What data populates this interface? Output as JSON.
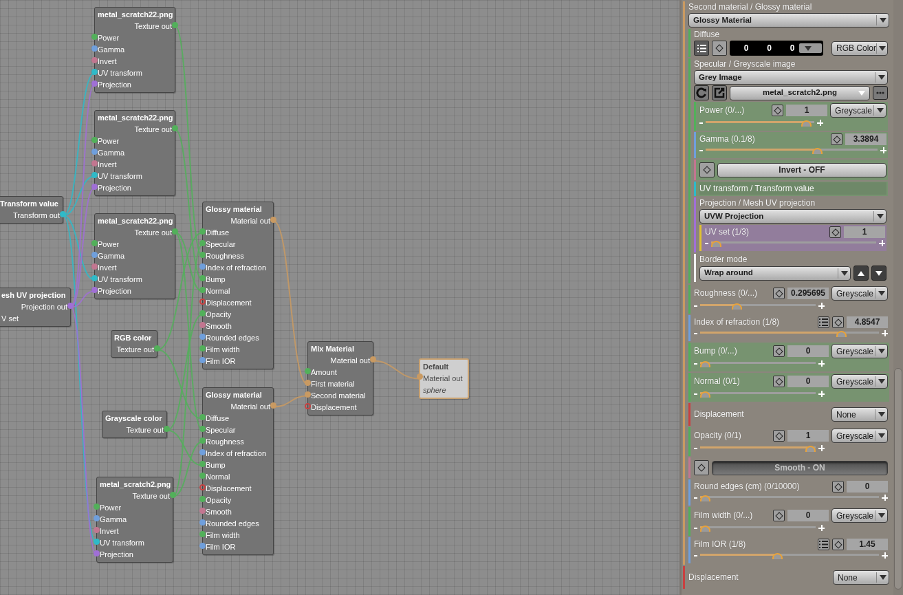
{
  "canvas": {
    "nodes": [
      {
        "title": "metal_scratch22.png",
        "outputs": [
          {
            "label": "Texture out",
            "kind": "texture"
          }
        ],
        "inputs": [
          {
            "label": "Power",
            "kind": "texture"
          },
          {
            "label": "Gamma",
            "kind": "float"
          },
          {
            "label": "Invert",
            "kind": "bool"
          },
          {
            "label": "UV transform",
            "kind": "transform"
          },
          {
            "label": "Projection",
            "kind": "projection"
          }
        ],
        "selected": false
      },
      {
        "title": "metal_scratch22.png",
        "outputs": [
          {
            "label": "Texture out",
            "kind": "texture"
          }
        ],
        "inputs": [
          {
            "label": "Power",
            "kind": "texture"
          },
          {
            "label": "Gamma",
            "kind": "float"
          },
          {
            "label": "Invert",
            "kind": "bool"
          },
          {
            "label": "UV transform",
            "kind": "transform"
          },
          {
            "label": "Projection",
            "kind": "projection"
          }
        ],
        "selected": false
      },
      {
        "title": "metal_scratch22.png",
        "outputs": [
          {
            "label": "Texture out",
            "kind": "texture"
          }
        ],
        "inputs": [
          {
            "label": "Power",
            "kind": "texture"
          },
          {
            "label": "Gamma",
            "kind": "float"
          },
          {
            "label": "Invert",
            "kind": "bool"
          },
          {
            "label": "UV transform",
            "kind": "transform"
          },
          {
            "label": "Projection",
            "kind": "projection"
          }
        ],
        "selected": false
      },
      {
        "title": "Transform value",
        "outputs": [
          {
            "label": "Transform out",
            "kind": "transform"
          }
        ],
        "selected": false
      },
      {
        "title": "esh UV projection",
        "outputs": [
          {
            "label": "Projection out",
            "kind": "projection"
          }
        ],
        "inputs": [
          {
            "label": "V set"
          }
        ],
        "selected": false
      },
      {
        "title": "RGB color",
        "outputs": [
          {
            "label": "Texture out",
            "kind": "texture"
          }
        ],
        "selected": false
      },
      {
        "title": "Grayscale color",
        "outputs": [
          {
            "label": "Texture out",
            "kind": "texture"
          }
        ],
        "selected": false
      },
      {
        "title": "metal_scratch2.png",
        "outputs": [
          {
            "label": "Texture out",
            "kind": "texture"
          }
        ],
        "inputs": [
          {
            "label": "Power",
            "kind": "texture"
          },
          {
            "label": "Gamma",
            "kind": "float"
          },
          {
            "label": "Invert",
            "kind": "bool"
          },
          {
            "label": "UV transform",
            "kind": "transform"
          },
          {
            "label": "Projection",
            "kind": "projection"
          }
        ],
        "selected": false
      },
      {
        "title": "Glossy material",
        "outputs": [
          {
            "label": "Material out",
            "kind": "material"
          }
        ],
        "inputs": [
          {
            "label": "Diffuse",
            "kind": "texture"
          },
          {
            "label": "Specular",
            "kind": "texture"
          },
          {
            "label": "Roughness",
            "kind": "texture"
          },
          {
            "label": "Index of refraction",
            "kind": "float"
          },
          {
            "label": "Bump",
            "kind": "texture"
          },
          {
            "label": "Normal",
            "kind": "texture"
          },
          {
            "label": "Displacement",
            "kind": "displacement"
          },
          {
            "label": "Opacity",
            "kind": "texture"
          },
          {
            "label": "Smooth",
            "kind": "bool"
          },
          {
            "label": "Rounded edges",
            "kind": "float"
          },
          {
            "label": "Film width",
            "kind": "texture"
          },
          {
            "label": "Film IOR",
            "kind": "float"
          }
        ],
        "selected": false
      },
      {
        "title": "Glossy material",
        "outputs": [
          {
            "label": "Material out",
            "kind": "material"
          }
        ],
        "inputs": [
          {
            "label": "Diffuse",
            "kind": "texture"
          },
          {
            "label": "Specular",
            "kind": "texture"
          },
          {
            "label": "Roughness",
            "kind": "texture"
          },
          {
            "label": "Index of refraction",
            "kind": "float"
          },
          {
            "label": "Bump",
            "kind": "texture"
          },
          {
            "label": "Normal",
            "kind": "texture"
          },
          {
            "label": "Displacement",
            "kind": "displacement"
          },
          {
            "label": "Opacity",
            "kind": "texture"
          },
          {
            "label": "Smooth",
            "kind": "bool"
          },
          {
            "label": "Rounded edges",
            "kind": "float"
          },
          {
            "label": "Film width",
            "kind": "texture"
          },
          {
            "label": "Film IOR",
            "kind": "float"
          }
        ],
        "selected": false
      },
      {
        "title": "Mix Material",
        "outputs": [
          {
            "label": "Material out",
            "kind": "material"
          }
        ],
        "inputs": [
          {
            "label": "Amount",
            "kind": "texture"
          },
          {
            "label": "First material",
            "kind": "material"
          },
          {
            "label": "Second material",
            "kind": "material"
          },
          {
            "label": "Displacement",
            "kind": "displacement"
          }
        ],
        "selected": false
      },
      {
        "title": "Default",
        "inputs": [
          {
            "label": "Material out",
            "kind": "material"
          }
        ],
        "note": "sphere",
        "selected": true
      }
    ]
  },
  "inspector": [
    {
      "kind": "material",
      "label": "Second material / Glossy material",
      "color": "#c99a62",
      "value": "Glossy Material",
      "children": [
        {
          "kind": "color",
          "label": "Diffuse",
          "color": "#52b05a",
          "values": [
            "0",
            "0",
            "0"
          ],
          "mode": "RGB Color"
        },
        {
          "kind": "image",
          "label": "Specular / Greyscale image",
          "color": "#52b05a",
          "value": "Grey Image",
          "file": "metal_scratch2.png",
          "children": [
            {
              "kind": "slider",
              "label": "Power (0/...)",
              "color": "#52b05a",
              "tinted": true,
              "value": "1",
              "mode": "Greyscale",
              "level": 0.97
            },
            {
              "kind": "slider",
              "label": "Gamma (0.1/8)",
              "color": "#6f9fdc",
              "tinted": true,
              "value": "3.3894",
              "level": 0.66
            },
            {
              "kind": "toggle",
              "label": "Invert - OFF",
              "color": "#c27690",
              "tinted": true,
              "on": false
            },
            {
              "kind": "link",
              "label": "UV transform / Transform value",
              "color": "#2fbac8",
              "tinted": true
            },
            {
              "kind": "dropdown",
              "label": "Projection / Mesh UV projection",
              "color": "#a06fd6",
              "value": "UVW Projection",
              "children": [
                {
                  "kind": "slider",
                  "label": "UV set (1/3)",
                  "color": "#e0c230",
                  "tinted": true,
                  "value": "1",
                  "level": 0
                }
              ]
            },
            {
              "kind": "enum",
              "label": "Border mode",
              "color": "#f0f0f0",
              "value": "Wrap around"
            }
          ]
        },
        {
          "kind": "slider",
          "label": "Roughness (0/...)",
          "color": "#52b05a",
          "value": "0.295695",
          "mode": "Greyscale",
          "level": 0.3
        },
        {
          "kind": "slider",
          "label": "Index of refraction (1/8)",
          "color": "#6f9fdc",
          "list": true,
          "value": "4.8547",
          "level": 0.81
        },
        {
          "kind": "slider",
          "label": "Bump (0/...)",
          "color": "#52b05a",
          "tinted": true,
          "value": "0",
          "mode": "Greyscale",
          "level": 0
        },
        {
          "kind": "slider",
          "label": "Normal (0/1)",
          "color": "#52b05a",
          "tinted": true,
          "value": "0",
          "mode": "Greyscale",
          "level": 0
        },
        {
          "kind": "select",
          "label": "Displacement",
          "color": "#c94040",
          "value": "None"
        },
        {
          "kind": "slider",
          "label": "Opacity (0/1)",
          "color": "#52b05a",
          "value": "1",
          "mode": "Greyscale",
          "level": 1
        },
        {
          "kind": "toggle",
          "label": "Smooth - ON",
          "color": "#c27690",
          "on": true
        },
        {
          "kind": "slider",
          "label": "Round edges (cm) (0/10000)",
          "color": "#6f9fdc",
          "value": "0",
          "level": 0
        },
        {
          "kind": "slider",
          "label": "Film width (0/...)",
          "color": "#52b05a",
          "value": "0",
          "mode": "Greyscale",
          "level": 0
        },
        {
          "kind": "slider",
          "label": "Film IOR (1/8)",
          "color": "#6f9fdc",
          "list": true,
          "value": "1.45",
          "level": 0.43
        }
      ]
    },
    {
      "kind": "select",
      "label": "Displacement",
      "color": "#c94040",
      "value": "None"
    }
  ]
}
